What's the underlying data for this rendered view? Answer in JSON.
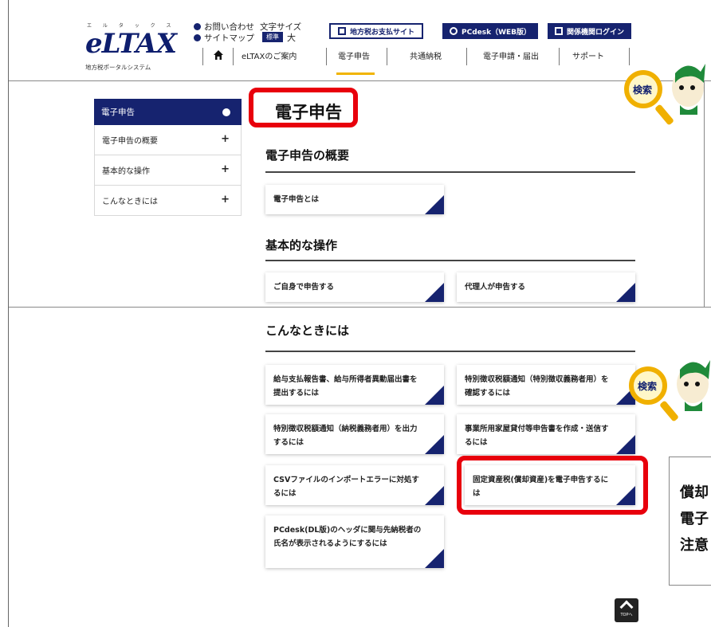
{
  "header": {
    "logo": {
      "ruby": "エ ル タ ッ ク ス",
      "mark": "eLTAX",
      "sub": "地方税ポータルシステム"
    },
    "util_links": {
      "contact": "お問い合わせ",
      "sitemap": "サイトマップ"
    },
    "font_size": {
      "label": "文字サイズ",
      "standard": "標準",
      "large": "大"
    },
    "buttons": {
      "payment_site": "地方税お支払サイト",
      "pcdesk": "PCdesk（WEB版）",
      "agency_login": "関係機関ログイン"
    },
    "global_nav": [
      "eLTAXのご案内",
      "電子申告",
      "共通納税",
      "電子申請・届出",
      "サポート"
    ],
    "active_nav": "電子申告"
  },
  "sidebar": {
    "head": "電子申告",
    "items": [
      {
        "label": "電子申告の概要"
      },
      {
        "label": "基本的な操作"
      },
      {
        "label": "こんなときには"
      }
    ]
  },
  "main": {
    "title": "電子申告",
    "sections": [
      {
        "heading": "電子申告の概要",
        "cards": [
          "電子申告とは"
        ]
      },
      {
        "heading": "基本的な操作",
        "cards": [
          "ご自身で申告する",
          "代理人が申告する"
        ]
      },
      {
        "heading": "こんなときには",
        "cards": [
          "給与支払報告書、給与所得者異動届出書を提出するには",
          "特別徴収税額通知（特別徴収義務者用）を確認するには",
          "特別徴収税額通知（納税義務者用）を出力するには",
          "事業所用家屋貸付等申告書を作成・送信するには",
          "CSVファイルのインポートエラーに対処するには",
          "固定資産税(償却資産)を電子申告するには",
          "PCdesk(DL版)のヘッダに関与先納税者の氏名が表示されるようにするには"
        ]
      }
    ]
  },
  "search_label": "検索",
  "callout_lines": [
    "償却",
    "電子",
    "注意"
  ],
  "to_top_label": "TOPへ",
  "colors": {
    "navy": "#16236f",
    "highlight": "#e8000c",
    "accent": "#f1b400"
  }
}
